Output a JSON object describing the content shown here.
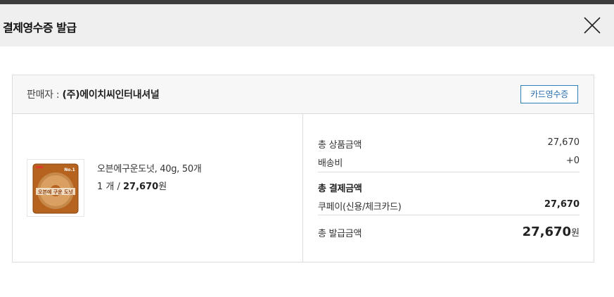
{
  "header": {
    "title": "결제영수증 발급"
  },
  "seller": {
    "label": "판매자 : ",
    "name": "(주)에이치씨인터내셔널"
  },
  "card_receipt_button": "카드영수증",
  "product": {
    "name": "오븐에구운도넛, 40g, 50개",
    "qty_text": "1 개 / ",
    "price": "27,670",
    "price_unit": "원",
    "image_text_badge": "No.1",
    "image_text_main": "오븐에 구운 도넛"
  },
  "summary": {
    "goods_label": "총 상품금액",
    "goods_value": "27,670",
    "shipping_label": "배송비",
    "shipping_value": "+0",
    "payment_title": "총 결제금액",
    "payment_method_label": "쿠페이(신용/체크카드)",
    "payment_method_value": "27,670",
    "issue_label": "총 발급금액",
    "issue_value": "27,670",
    "issue_unit": "원"
  },
  "colors": {
    "accent": "#2c7fb8",
    "header_bg": "#efefef",
    "top_bar": "#3c3c3c"
  }
}
